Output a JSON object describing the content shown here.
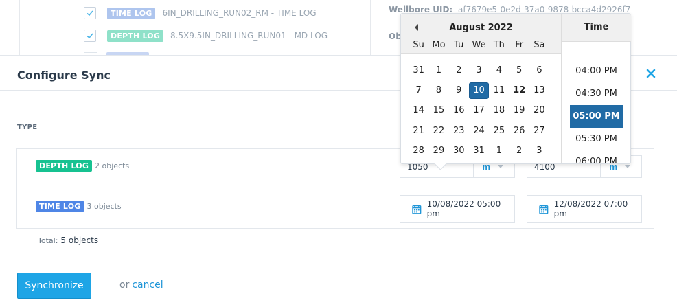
{
  "background": {
    "rows": [
      {
        "tag": "TIME LOG",
        "label": "6IN_DRILLING_RUN02_RM - TIME LOG"
      },
      {
        "tag": "DEPTH LOG",
        "label": "8.5X9.5IN_DRILLING_RUN01 - MD LOG"
      }
    ],
    "wellbore_uid_label": "Wellbore UID:",
    "wellbore_uid_value": "af7679e5-0e2d-37a0-9878-bcca4d2926f7",
    "ob_label": "Ob"
  },
  "modal": {
    "title": "Configure Sync",
    "type_header": "TYPE",
    "rows": [
      {
        "tag": "DEPTH LOG",
        "count": "2 objects",
        "start": "1050",
        "start_unit": "m",
        "end": "4100",
        "end_unit": "m"
      },
      {
        "tag": "TIME LOG",
        "count": "3 objects",
        "start": "10/08/2022 05:00 pm",
        "end": "12/08/2022 07:00 pm"
      }
    ],
    "total_label": "Total:",
    "total_value": "5 objects",
    "sync_button": "Synchronize",
    "or_text": "or",
    "cancel_link": "cancel"
  },
  "datepicker": {
    "month": "August 2022",
    "weekdays": [
      "Su",
      "Mo",
      "Tu",
      "We",
      "Th",
      "Fr",
      "Sa"
    ],
    "weeks": [
      [
        "31",
        "1",
        "2",
        "3",
        "4",
        "5",
        "6"
      ],
      [
        "7",
        "8",
        "9",
        "10",
        "11",
        "12",
        "13"
      ],
      [
        "14",
        "15",
        "16",
        "17",
        "18",
        "19",
        "20"
      ],
      [
        "21",
        "22",
        "23",
        "24",
        "25",
        "26",
        "27"
      ],
      [
        "28",
        "29",
        "30",
        "31",
        "1",
        "2",
        "3"
      ]
    ],
    "selected_day": "10",
    "today_day": "12",
    "time_header": "Time",
    "times": [
      "04:00 PM",
      "04:30 PM",
      "05:00 PM",
      "05:30 PM",
      "06:00 PM"
    ],
    "selected_time": "05:00 PM"
  },
  "colors": {
    "depth_tag": "#17c291",
    "time_tag": "#4f86e6",
    "primary": "#1ea5e6",
    "selected": "#216ba5",
    "link": "#2096d8"
  }
}
